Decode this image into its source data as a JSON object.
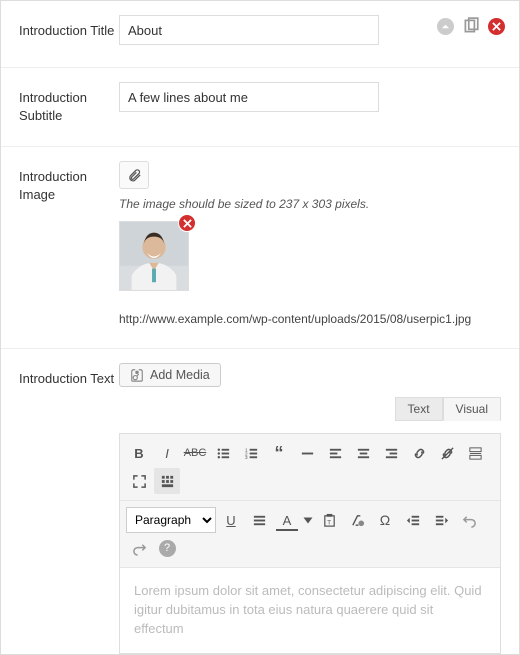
{
  "fields": {
    "title": {
      "label": "Introduction Title",
      "value": "About"
    },
    "subtitle": {
      "label": "Introduction Subtitle",
      "value": "A few lines about me"
    },
    "image": {
      "label": "Introduction Image",
      "hint": "The image should be sized to 237 x 303 pixels.",
      "url": "http://www.example.com/wp-content/uploads/2015/08/userpic1.jpg"
    },
    "text": {
      "label": "Introduction Text",
      "add_media": "Add Media",
      "tabs": {
        "text": "Text",
        "visual": "Visual"
      },
      "format_select": "Paragraph",
      "body": "Lorem ipsum dolor sit amet, consectetur adipiscing elit. Quid igitur dubitamus in tota eius natura quaerere quid sit effectum"
    }
  }
}
